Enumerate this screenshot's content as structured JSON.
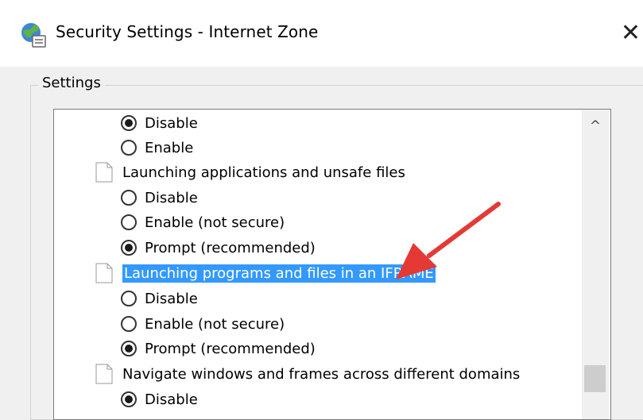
{
  "window": {
    "title": "Security Settings - Internet Zone",
    "close_glyph": "✕",
    "icon": "globe-settings-icon"
  },
  "settings_group": {
    "label": "Settings"
  },
  "settings_list": [
    {
      "kind": "radio",
      "label": "Disable",
      "checked": true
    },
    {
      "kind": "radio",
      "label": "Enable",
      "checked": false
    },
    {
      "kind": "category",
      "label": "Launching applications and unsafe files",
      "selected": false
    },
    {
      "kind": "radio",
      "label": "Disable",
      "checked": false
    },
    {
      "kind": "radio",
      "label": "Enable (not secure)",
      "checked": false
    },
    {
      "kind": "radio",
      "label": "Prompt (recommended)",
      "checked": true
    },
    {
      "kind": "category",
      "label": "Launching programs and files in an IFRAME",
      "selected": true
    },
    {
      "kind": "radio",
      "label": "Disable",
      "checked": false
    },
    {
      "kind": "radio",
      "label": "Enable (not secure)",
      "checked": false
    },
    {
      "kind": "radio",
      "label": "Prompt (recommended)",
      "checked": true
    },
    {
      "kind": "category",
      "label": "Navigate windows and frames across different domains",
      "selected": false
    },
    {
      "kind": "radio",
      "label": "Disable",
      "checked": true
    }
  ],
  "scrollbar": {
    "up_glyph": "^"
  },
  "annotation": {
    "arrow_color": "#e53935"
  },
  "colors": {
    "selection": "#3399ff"
  }
}
